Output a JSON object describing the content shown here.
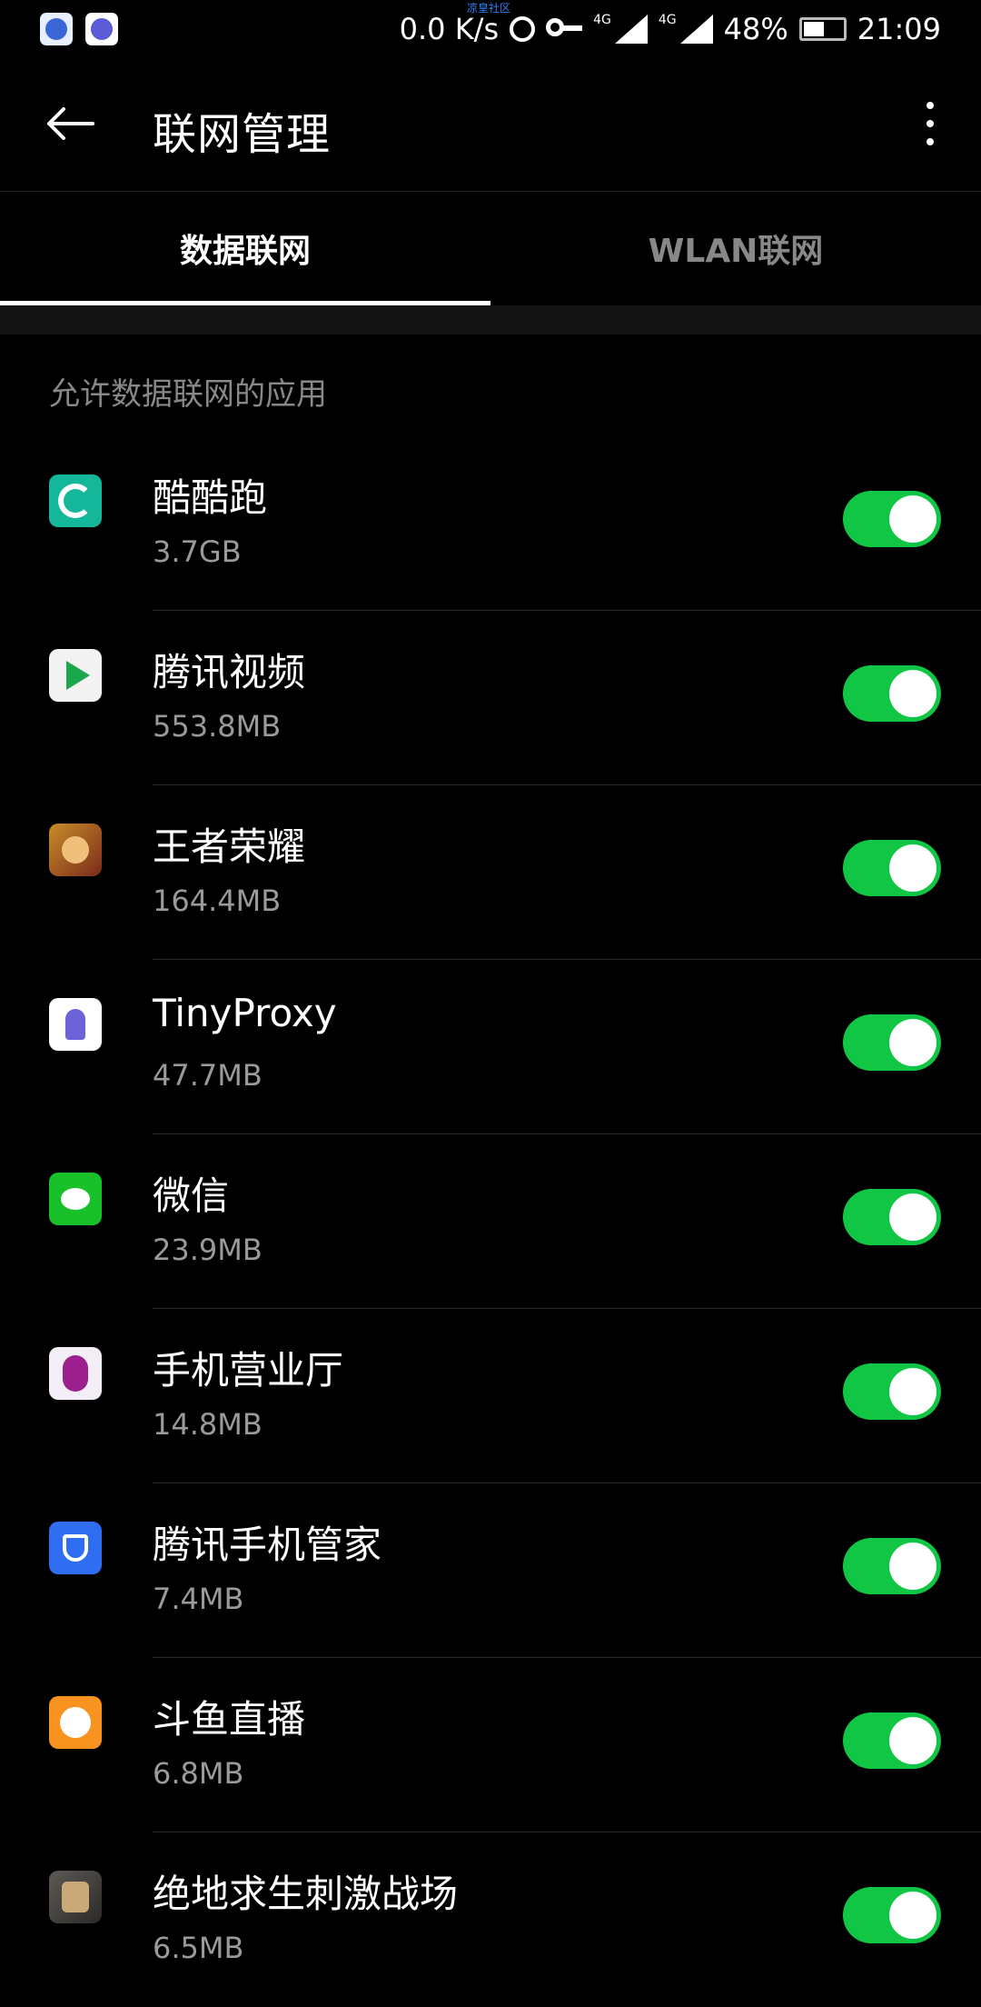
{
  "status_bar": {
    "network_speed": "0.0 K/s",
    "carrier_note": "凉皇社区",
    "net1": "4G",
    "net2": "4G",
    "battery": "48%",
    "time": "21:09",
    "icons": [
      "du-app-icon",
      "tinyproxy-app-icon",
      "alarm-icon",
      "key-icon",
      "signal-icon",
      "signal-icon",
      "battery-icon"
    ]
  },
  "app_bar": {
    "title": "联网管理",
    "back_icon": "arrow-left-icon",
    "more_icon": "more-vertical-icon"
  },
  "tabs": [
    {
      "label": "数据联网",
      "active": true
    },
    {
      "label": "WLAN联网",
      "active": false
    }
  ],
  "section_title": "允许数据联网的应用",
  "apps": [
    {
      "name": "酷酷跑",
      "usage": "3.7GB",
      "enabled": true,
      "icon": "kukupao-icon"
    },
    {
      "name": "腾讯视频",
      "usage": "553.8MB",
      "enabled": true,
      "icon": "tencent-video-icon"
    },
    {
      "name": "王者荣耀",
      "usage": "164.4MB",
      "enabled": true,
      "icon": "king-of-glory-icon"
    },
    {
      "name": "TinyProxy",
      "usage": "47.7MB",
      "enabled": true,
      "icon": "tinyproxy-icon"
    },
    {
      "name": "微信",
      "usage": "23.9MB",
      "enabled": true,
      "icon": "wechat-icon"
    },
    {
      "name": "手机营业厅",
      "usage": "14.8MB",
      "enabled": true,
      "icon": "unicom-icon"
    },
    {
      "name": "腾讯手机管家",
      "usage": "7.4MB",
      "enabled": true,
      "icon": "tencent-manager-icon"
    },
    {
      "name": "斗鱼直播",
      "usage": "6.8MB",
      "enabled": true,
      "icon": "douyu-icon"
    },
    {
      "name": "绝地求生刺激战场",
      "usage": "6.5MB",
      "enabled": true,
      "icon": "pubg-icon"
    }
  ],
  "colors": {
    "background": "#000000",
    "toggle_on": "#12c645",
    "secondary_text": "#9a9a9a"
  }
}
